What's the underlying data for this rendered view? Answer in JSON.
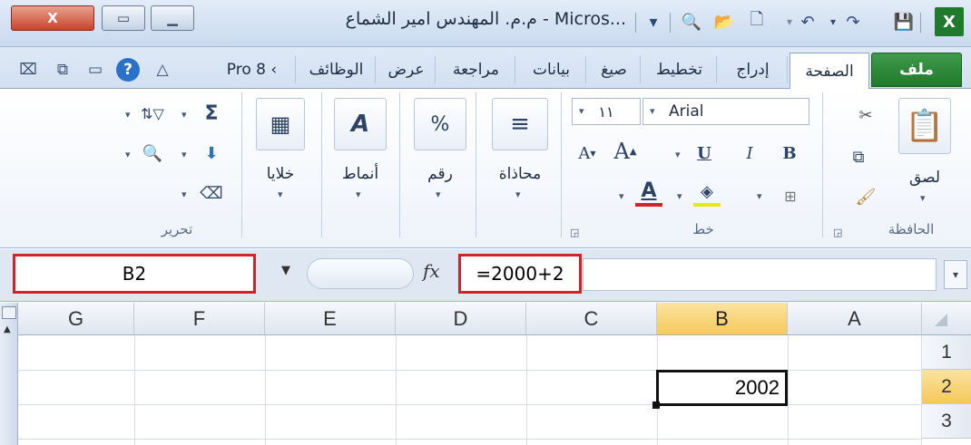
{
  "window": {
    "title": "م.م. المهندس امير الشماع - Micros...",
    "close_label": "X",
    "restore_label": "▭",
    "min_label": "▁"
  },
  "tabs": [
    {
      "label": "ملف"
    },
    {
      "label": "الصفحة"
    },
    {
      "label": "إدراج"
    },
    {
      "label": "تخطيط"
    },
    {
      "label": "صيغ"
    },
    {
      "label": "بيانات"
    },
    {
      "label": "مراجعة"
    },
    {
      "label": "عرض"
    },
    {
      "label": "الوظائف"
    },
    {
      "label": "Pro 8 ‹"
    }
  ],
  "ribbon": {
    "clipboard": {
      "paste_label": "لصق",
      "group_label": "الحافظة"
    },
    "font": {
      "name": "Arial",
      "size": "١١",
      "group_label": "خط"
    },
    "alignment": {
      "label": "محاذاة"
    },
    "number": {
      "label": "رقم"
    },
    "styles": {
      "label": "أنماط"
    },
    "cells": {
      "label": "خلايا"
    },
    "editing": {
      "group_label": "تحرير"
    }
  },
  "formula_bar": {
    "name_box": "B2",
    "fx": "fx",
    "formula": "=2000+2"
  },
  "sheet": {
    "columns": [
      "G",
      "F",
      "E",
      "D",
      "C",
      "B",
      "A"
    ],
    "rows": [
      "1",
      "2",
      "3"
    ],
    "selected_column": "B",
    "selected_row": "2",
    "active_cell_value": "2002"
  },
  "colors": {
    "highlight_border": "#d2232a",
    "file_tab": "#1f7a2c",
    "selected_header": "#f5c85a"
  }
}
